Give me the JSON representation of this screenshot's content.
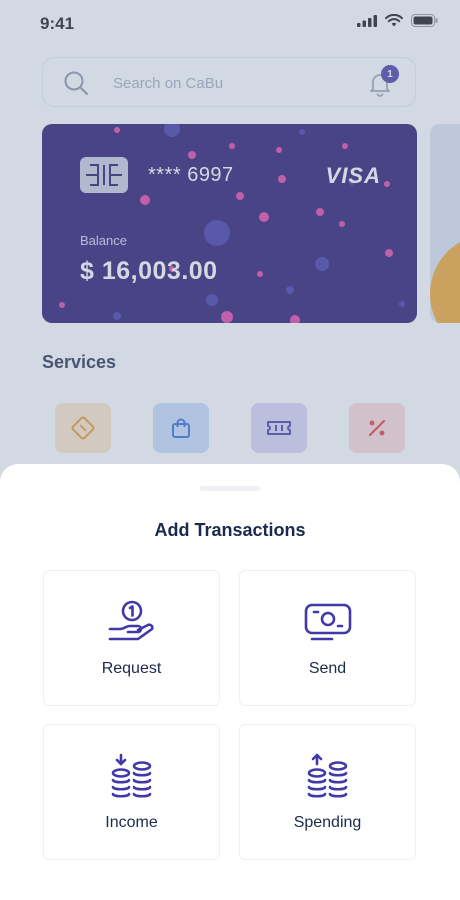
{
  "status_bar": {
    "time": "9:41"
  },
  "search": {
    "placeholder": "Search on CaBu",
    "notification_count": "1"
  },
  "card": {
    "number": "**** 6997",
    "brand": "VISA",
    "balance_label": "Balance",
    "balance_value": "$ 16,003.00",
    "color": "#1f0f6b",
    "dot_color": "#e23ba6"
  },
  "services": {
    "title": "Services",
    "items": [
      {
        "icon": "swap-card-icon",
        "bg": "#fde7c9",
        "color": "#e7962a"
      },
      {
        "icon": "shopping-bag-icon",
        "bg": "#c7ddff",
        "color": "#2f6ad9"
      },
      {
        "icon": "ticket-icon",
        "bg": "#d9d3f7",
        "color": "#4338a8"
      },
      {
        "icon": "percent-icon",
        "bg": "#fbd9d9",
        "color": "#e23b3b"
      }
    ]
  },
  "sheet": {
    "title": "Add Transactions",
    "accent": "#4338a8",
    "options": [
      {
        "label": "Request",
        "icon": "hand-coin-icon"
      },
      {
        "label": "Send",
        "icon": "banknote-icon"
      },
      {
        "label": "Income",
        "icon": "coins-arrow-down-icon"
      },
      {
        "label": "Spending",
        "icon": "coins-arrow-up-icon"
      }
    ]
  }
}
